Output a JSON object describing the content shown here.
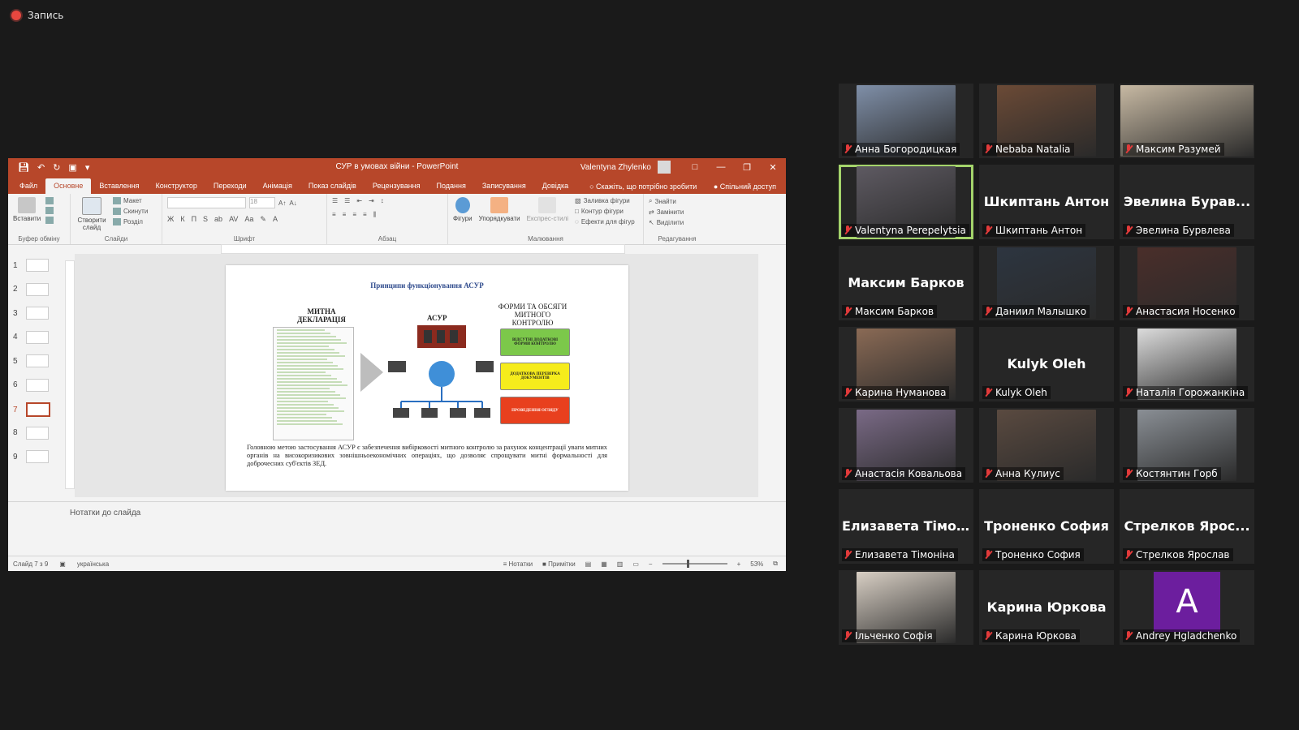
{
  "recording": {
    "label": "Запись"
  },
  "colors": {
    "ppt_accent": "#b7472a",
    "active_speaker": "#a4d46b",
    "muted": "#e23a3a",
    "avatar_bg": "#6c1e9e"
  },
  "ppt": {
    "title": "СУР в умовах війни - PowerPoint",
    "user": "Valentyna Zhylenko",
    "tabs": [
      "Файл",
      "Основне",
      "Вставлення",
      "Конструктор",
      "Переходи",
      "Анімація",
      "Показ слайдів",
      "Рецензування",
      "Подання",
      "Записування",
      "Довідка"
    ],
    "active_tab": "Основне",
    "tell_me": "Скажіть, що потрібно зробити",
    "share": "Спільний доступ",
    "ribbon": {
      "clipboard": {
        "label": "Буфер обміну",
        "paste": "Вставити"
      },
      "slides": {
        "label": "Слайди",
        "new_slide": "Створити слайд",
        "layout": "Макет",
        "reset": "Скинути",
        "section": "Розділ"
      },
      "font": {
        "label": "Шрифт",
        "size": "18"
      },
      "paragraph": {
        "label": "Абзац"
      },
      "drawing": {
        "label": "Малювання",
        "shapes": "Фігури",
        "arrange": "Упорядкувати",
        "quick_styles": "Експрес-стилі",
        "fill": "Заливка фігури",
        "outline": "Контур фігури",
        "effects": "Ефекти для фігур"
      },
      "editing": {
        "label": "Редагування",
        "find": "Знайти",
        "replace": "Замінити",
        "select": "Виділити"
      }
    },
    "thumbnails": [
      "1",
      "2",
      "3",
      "4",
      "5",
      "6",
      "7",
      "8",
      "9"
    ],
    "active_slide": "7",
    "slide": {
      "title": "Принципи функціонування АСУР",
      "decl_title": "МИТНА ДЕКЛАРАЦІЯ",
      "acur_label": "АСУР",
      "forms_title": "ФОРМИ ТА ОБСЯГИ МИТНОГО КОНТРОЛЮ",
      "boxes": [
        {
          "text": "ВІДСУТНІ ДОДАТКОВІ ФОРМИ КОНТРОЛЮ",
          "color": "#7cc84a"
        },
        {
          "text": "ДОДАТКОВА ПЕРЕВІРКА ДОКУМЕНТІВ",
          "color": "#f6ec1c"
        },
        {
          "text": "ПРОВЕДЕННЯ ОГЛЯДУ",
          "color": "#e8401e"
        }
      ],
      "body": "Головною метою застосування АСУР є забезпечення вибірковості митного контролю за рахунок концентрації уваги митних органів на високоризикових зовнішньоекономічних операціях, що дозволяє спрощувати митні формальності для доброчесних суб'єктів ЗЕД."
    },
    "notes_placeholder": "Нотатки до слайда",
    "status": {
      "slide_of": "Слайд 7 з 9",
      "language": "українська",
      "notes": "Нотатки",
      "comments": "Примітки",
      "zoom": "53%"
    }
  },
  "participants": [
    {
      "name": "Анна Богородицкая",
      "video": true,
      "bg": "#7f8fa8"
    },
    {
      "name": "Nebaba Natalia",
      "video": true,
      "bg": "#6b4a36"
    },
    {
      "name": "Максим Разумей",
      "video": true,
      "bg": "#c7b9a3"
    },
    {
      "name": "Valentyna Perepelytsia",
      "video": true,
      "bg": "#5e5a62",
      "active": true
    },
    {
      "name": "Шкиптань Антон",
      "display": "Шкиптань Антон",
      "video": false
    },
    {
      "name": "Эвелина Бурвлева",
      "display": "Эвелина Бурав...",
      "video": false
    },
    {
      "name": "Максим Барков",
      "display": "Максим Барков",
      "video": false
    },
    {
      "name": "Даниил Малышко",
      "video": true,
      "bg": "#2d3540"
    },
    {
      "name": "Анастасия Носенко",
      "video": true,
      "bg": "#4a2e2a"
    },
    {
      "name": "Карина Нуманова",
      "video": true,
      "bg": "#8a6a55"
    },
    {
      "name": "Kulyk Oleh",
      "display": "Kulyk Oleh",
      "video": false
    },
    {
      "name": "Наталія Горожанкіна",
      "video": true,
      "bg": "#dcdcdc"
    },
    {
      "name": "Анастасія Ковальова",
      "video": true,
      "bg": "#7a6a86"
    },
    {
      "name": "Анна Кулиус",
      "video": true,
      "bg": "#5a4a40"
    },
    {
      "name": "Костянтин Горб",
      "video": true,
      "bg": "#8a8f95"
    },
    {
      "name": "Елизавета Тімоніна",
      "display": "Елизавета Тімо...",
      "video": false
    },
    {
      "name": "Троненко София",
      "display": "Троненко София",
      "video": false
    },
    {
      "name": "Стрелков Ярослав",
      "display": "Стрелков Ярос...",
      "video": false
    },
    {
      "name": "Ільченко Софія",
      "video": true,
      "bg": "#d8cfc4"
    },
    {
      "name": "Карина Юркова",
      "display": "Карина Юркова",
      "video": false
    },
    {
      "name": "Andrey Hgladchenko",
      "avatar_letter": "A",
      "video": false
    }
  ]
}
